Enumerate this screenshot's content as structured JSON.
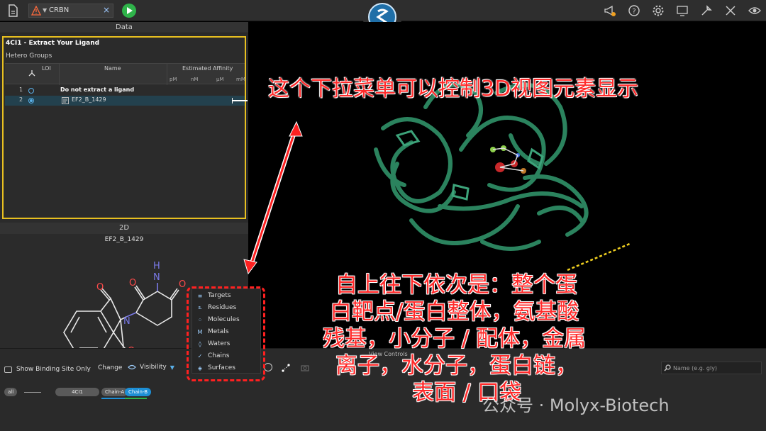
{
  "topbar": {
    "tab_name": "CRBN",
    "tab_close": "×",
    "icons": [
      "megaphone-icon",
      "help-icon",
      "gear-icon",
      "screen-icon",
      "tools-icon",
      "settings-tools-icon",
      "eye-icon"
    ]
  },
  "data_panel": {
    "title": "Data",
    "box_title": "4CI1 - Extract Your Ligand",
    "section": "Hetero Groups",
    "columns": {
      "loi": "LOI",
      "name": "Name",
      "affinity": "Estimated Affinity",
      "units": [
        "pM",
        "nM",
        "μM",
        "mM"
      ]
    },
    "rows": [
      {
        "index": "1",
        "name": "Do not extract a ligand"
      },
      {
        "index": "2",
        "name": "EF2_B_1429"
      }
    ]
  },
  "panel_2d": {
    "title": "2D",
    "molecule_name": "EF2_B_1429",
    "atoms": {
      "o1": "O",
      "o2": "O",
      "o3": "O",
      "o4": "O",
      "n1": "N",
      "nh": "H",
      "nh_n": "N"
    }
  },
  "view_controls": {
    "title": "View Controls",
    "binding_site": "Show Binding Site Only",
    "change": "Change",
    "visibility": "Visibility",
    "search_placeholder": "Name (e.g. gly)",
    "chips": {
      "all": "all",
      "pdb": "4CI1",
      "chain_a": "Chain-A",
      "chain_b": "Chain-B"
    }
  },
  "visibility_menu": [
    "Targets",
    "Residues",
    "Molecules",
    "Metals",
    "Waters",
    "Chains",
    "Surfaces"
  ],
  "annotations": {
    "top": "这个下拉菜单可以控制3D视图元素显示",
    "lines": [
      "自上往下依次是：整个蛋",
      "白靶点/蛋白整体，氨基酸",
      "残基，小分子 / 配体，金属",
      "离子，水分子，蛋白链，",
      "表面 / 口袋"
    ]
  },
  "watermark": "公众号 · Molyx-Biotech",
  "colors": {
    "accent_blue": "#1d8fd6",
    "highlight_yellow": "#e8c020",
    "annotation_red": "#ff2a2a",
    "protein_green": "#2e8b64"
  }
}
